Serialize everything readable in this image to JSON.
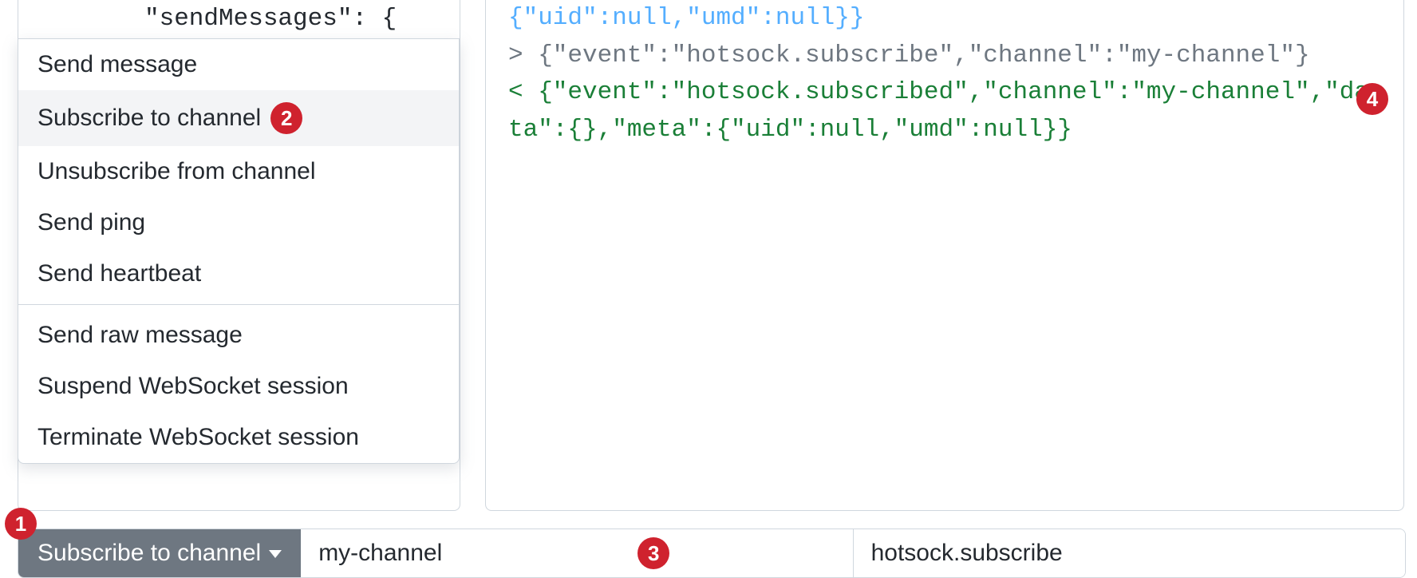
{
  "code_header": "\"sendMessages\": {",
  "menu": {
    "group1": [
      "Send message",
      "Subscribe to channel",
      "Unsubscribe from channel",
      "Send ping",
      "Send heartbeat"
    ],
    "group2": [
      "Send raw message",
      "Suspend WebSocket session",
      "Terminate WebSocket session"
    ],
    "highlighted_index": 1
  },
  "log": {
    "line1": "{\"uid\":null,\"umd\":null}}",
    "line2": "> {\"event\":\"hotsock.subscribe\",\"channel\":\"my-channel\"}",
    "line3": "< {\"event\":\"hotsock.subscribed\",\"channel\":\"my-channel\",\"data\":{},\"meta\":{\"uid\":null,\"umd\":null}}"
  },
  "bottom_bar": {
    "action_label": "Subscribe to channel",
    "channel_value": "my-channel",
    "event_value": "hotsock.subscribe"
  },
  "badges": {
    "b1": "1",
    "b2": "2",
    "b3": "3",
    "b4": "4"
  }
}
